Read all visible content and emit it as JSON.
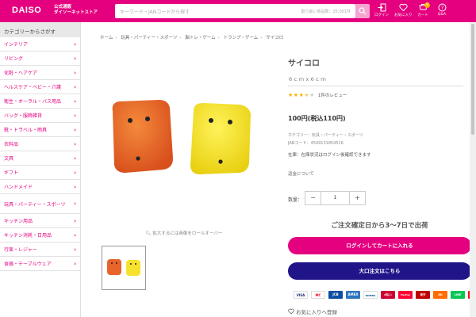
{
  "header": {
    "logo": "DAISO",
    "logo_sub_1": "公式通販",
    "logo_sub_2": "ダイソーネットストア",
    "search_placeholder": "キーワード・JANコードから探す",
    "search_note": "取り扱い商品数：25,001件",
    "icons": [
      {
        "name": "login-icon",
        "label": "ログイン"
      },
      {
        "name": "heart-icon",
        "label": "お気に入り"
      },
      {
        "name": "cart-icon",
        "label": "カート",
        "badge": "0"
      },
      {
        "name": "help-icon",
        "label": "Q&A"
      }
    ],
    "brand_color": "#e5007f"
  },
  "sidebar": {
    "heading": "カテゴリーからさがす",
    "items": [
      "インテリア",
      "リビング",
      "化粧・ヘアケア",
      "ヘルスケア・ベビー・介護",
      "衛生・オーラル・バス用品",
      "バッグ・服飾雑貨",
      "靴・トラベル・雨具",
      "衣料品",
      "文具",
      "ギフト",
      "ハンドメイド",
      "玩具・パーティー・スポーツ",
      "キッチン用品",
      "キッチン消耗・日用品",
      "行楽・レジャー",
      "食器・テーブルウェア"
    ]
  },
  "breadcrumb": [
    "ホーム",
    "玩具・パーティー・スポーツ",
    "脳トレ・ゲーム",
    "トランプ・ゲーム",
    "サイコロ"
  ],
  "product": {
    "title": "サイコロ",
    "size": "6ｃｍｘ6ｃｍ",
    "rating": 3.5,
    "review_link": "1件のレビュー",
    "price": "100円(税込110円)",
    "category": "カテゴリー：玩具・パーティー・スポーツ",
    "jan": "JANコード：4549131854516",
    "stock": "在庫：在庫状況はログイン後確認できます",
    "notice": "返金について",
    "qty_label": "数量：",
    "qty_value": "1",
    "qty_minus": "−",
    "qty_plus": "+",
    "zoom_hint": "拡大するには画像をロールオーバー",
    "ship_note": "ご注文確定日から3〜7日で出荷",
    "cart_button": "ログインしてカートに入れる",
    "bulk_button": "大口注文はこちら",
    "favorite": "お気に入りへ登録",
    "payments": [
      "VISA",
      "MC",
      "JCB",
      "AMEX",
      "DINERS",
      "d払い",
      "PayPay",
      "楽天",
      "au",
      "LINE",
      "メルペイ"
    ],
    "accent_blue": "#1f1488"
  }
}
